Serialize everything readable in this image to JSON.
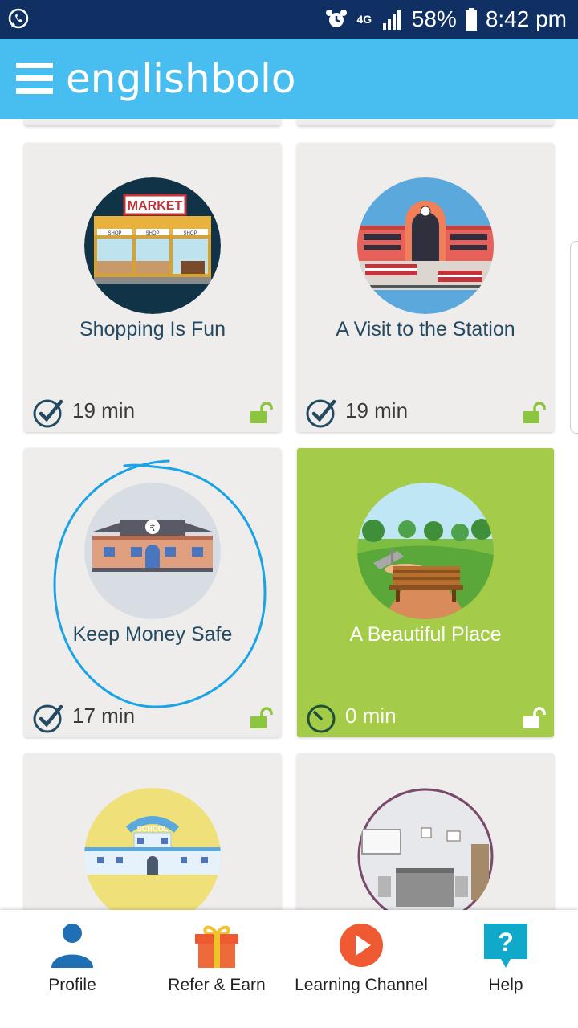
{
  "status_bar": {
    "network": "4G",
    "battery": "58%",
    "time": "8:42 pm"
  },
  "app": {
    "brand": "englishbolo"
  },
  "cards": [
    {
      "title": "Shopping Is Fun",
      "duration": "19 min",
      "scene": "market-illustration",
      "state": "completed"
    },
    {
      "title": "A Visit to the Station",
      "duration": "19 min",
      "scene": "station-illustration",
      "state": "completed"
    },
    {
      "title": "Keep Money Safe",
      "duration": "17 min",
      "scene": "bank-illustration",
      "state": "completed"
    },
    {
      "title": "A Beautiful Place",
      "duration": "0 min",
      "scene": "park-illustration",
      "state": "active"
    },
    {
      "title": "",
      "duration": "",
      "scene": "school-illustration",
      "state": "partial"
    },
    {
      "title": "",
      "duration": "",
      "scene": "office-illustration",
      "state": "partial"
    }
  ],
  "illustration_text": {
    "market_sign": "MARKET",
    "shop": "SHOP",
    "school_sign": "SCHOOL"
  },
  "bottom_nav": [
    {
      "label": "Profile",
      "icon": "person-icon"
    },
    {
      "label": "Refer & Earn",
      "icon": "gift-icon"
    },
    {
      "label": "Learning Channel",
      "icon": "play-icon"
    },
    {
      "label": "Help",
      "icon": "help-icon"
    }
  ],
  "colors": {
    "status_bar": "#103064",
    "app_bar": "#48bdef",
    "active_card": "#a4cc48",
    "lock": "#8cc63f",
    "annotation": "#1aa3e6"
  }
}
